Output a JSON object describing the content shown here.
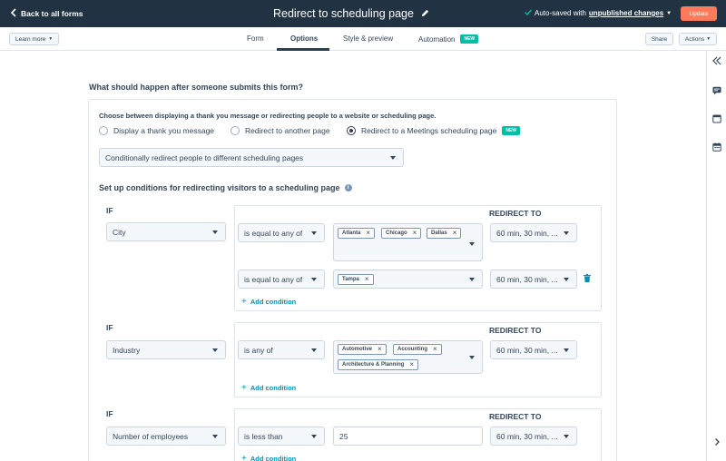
{
  "topbar": {
    "back_label": "Back to all forms",
    "title": "Redirect to scheduling page",
    "autosave_prefix": "Auto-saved with",
    "autosave_link": "unpublished changes",
    "update_label": "Update"
  },
  "subbar": {
    "learn_more": "Learn more",
    "tabs": [
      {
        "label": "Form"
      },
      {
        "label": "Options"
      },
      {
        "label": "Style & preview"
      },
      {
        "label": "Automation",
        "badge": "NEW"
      }
    ],
    "share": "Share",
    "actions": "Actions"
  },
  "main": {
    "question": "What should happen after someone submits this form?",
    "choose_text": "Choose between displaying a thank you message or redirecting people to a website or scheduling page.",
    "radio_options": [
      {
        "label": "Display a thank you message",
        "checked": false
      },
      {
        "label": "Redirect to another page",
        "checked": false
      },
      {
        "label": "Redirect to a Meetings scheduling page",
        "checked": true,
        "badge": "NEW"
      }
    ],
    "redirect_mode": "Conditionally redirect people to different scheduling pages",
    "setup_title": "Set up conditions for redirecting visitors to a scheduling page",
    "if_label": "IF",
    "redirect_to_label": "REDIRECT TO",
    "add_condition": "Add condition",
    "conditions": [
      {
        "property": "City",
        "rules": [
          {
            "operator": "is equal to any of",
            "values": [
              "Atlanta",
              "Chicago",
              "Dallas"
            ],
            "redirect": "60 min, 30 min, ..."
          },
          {
            "operator": "is equal to any of",
            "values": [
              "Tampa"
            ],
            "redirect": "60 min, 30 min, ..."
          }
        ]
      },
      {
        "property": "Industry",
        "rules": [
          {
            "operator": "is any of",
            "values": [
              "Automotive",
              "Accounting",
              "Architecture & Planning"
            ],
            "redirect": "60 min, 30 min, ..."
          }
        ]
      },
      {
        "property": "Number of employees",
        "rules": [
          {
            "operator": "is less than",
            "value": "25",
            "redirect": "60 min, 30 min, ..."
          }
        ]
      }
    ]
  }
}
